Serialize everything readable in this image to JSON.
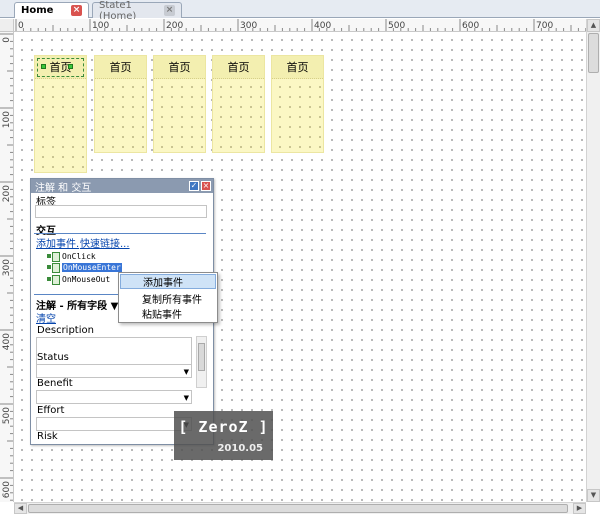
{
  "tabs": [
    {
      "label": "Home",
      "active": true
    },
    {
      "label": "State1 (Home)",
      "active": false
    }
  ],
  "rulers": {
    "top_ticks": [
      "0",
      "100",
      "200",
      "300",
      "400",
      "500",
      "600",
      "700"
    ],
    "left_ticks": [
      "0",
      "100",
      "200",
      "300",
      "400",
      "500",
      "600"
    ]
  },
  "columns": [
    {
      "label": "首页",
      "selected": true
    },
    {
      "label": "首页",
      "selected": false
    },
    {
      "label": "首页",
      "selected": false
    },
    {
      "label": "首页",
      "selected": false
    },
    {
      "label": "首页",
      "selected": false
    }
  ],
  "panel": {
    "title": "注解 和 交互",
    "label_heading": "标签",
    "interaction_heading": "交互",
    "add_event_link": "添加事件.",
    "quick_link": "快速链接...",
    "events": [
      "OnClick",
      "OnMouseEnter",
      "OnMouseOut"
    ],
    "selected_event": "OnMouseEnter",
    "notes_heading": "注解 - 所有字段 ▼",
    "clear_link": "清空",
    "fields": [
      {
        "label": "Description",
        "type": "text"
      },
      {
        "label": "Status",
        "type": "select"
      },
      {
        "label": "Benefit",
        "type": "select"
      },
      {
        "label": "Effort",
        "type": "select"
      },
      {
        "label": "Risk",
        "type": "select"
      }
    ]
  },
  "context_menu": {
    "items": [
      "添加事件",
      "复制所有事件",
      "粘贴事件"
    ],
    "highlighted": "添加事件"
  },
  "watermark": {
    "title": "[ ZeroZ ]",
    "subtitle": "2010.05"
  },
  "colors": {
    "column_fill": "#fbf7c4",
    "panel_title": "#8b9ab0",
    "selection": "#3875d7",
    "link": "#0645ad"
  }
}
